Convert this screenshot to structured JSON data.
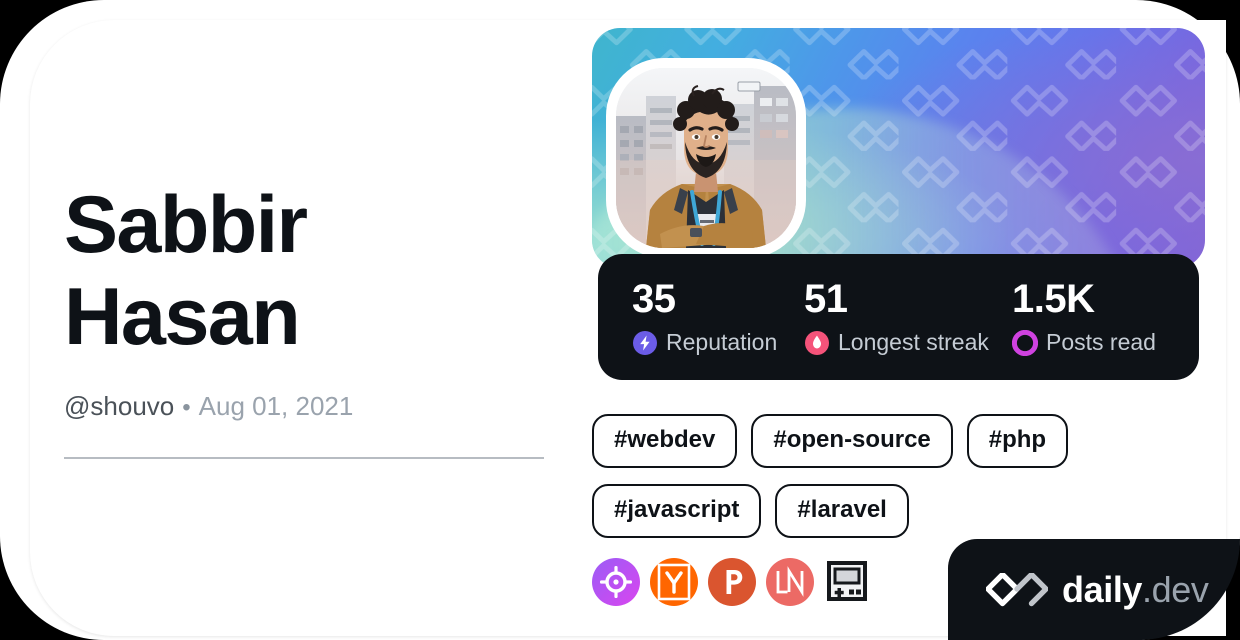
{
  "profile": {
    "name": "Sabbir Hasan",
    "handle": "@shouvo",
    "separator": "•",
    "joined_date": "Aug 01, 2021",
    "avatar_alt": "illustrated-portrait-bearded-man-city-background"
  },
  "cover": {
    "gradient_start": "#3fb5cd",
    "gradient_mid": "#5a83ee",
    "gradient_end": "#8063d8",
    "watermark": "daily-dev-chevron-pattern"
  },
  "stats": [
    {
      "value": "35",
      "label": "Reputation",
      "icon": "reputation-bolt-icon",
      "color": "#6b5ce7"
    },
    {
      "value": "51",
      "label": "Longest streak",
      "icon": "streak-flame-icon",
      "color": "#f5537a"
    },
    {
      "value": "1.5K",
      "label": "Posts read",
      "icon": "posts-read-ring-icon",
      "color": "#cf42e0"
    }
  ],
  "stats_bar": {
    "background": "#0e1217",
    "value_color": "#ffffff",
    "label_color": "#c5ccd4"
  },
  "tags": [
    "#webdev",
    "#open-source",
    "#php",
    "#javascript",
    "#laravel"
  ],
  "badges": [
    {
      "name": "target-crosshair-badge",
      "color": "#a855f7"
    },
    {
      "name": "hacker-news-y-badge",
      "color": "#ff6600"
    },
    {
      "name": "product-hunt-p-badge",
      "color": "#da552f"
    },
    {
      "name": "ln-badge",
      "color": "#ec6a65"
    },
    {
      "name": "retro-handheld-console-badge",
      "color": "#1a1a1a"
    }
  ],
  "brand": {
    "logo_mark": "daily-dev-chevron-logo",
    "name": "daily",
    "tld": ".dev",
    "chip_background": "#0e1217"
  }
}
